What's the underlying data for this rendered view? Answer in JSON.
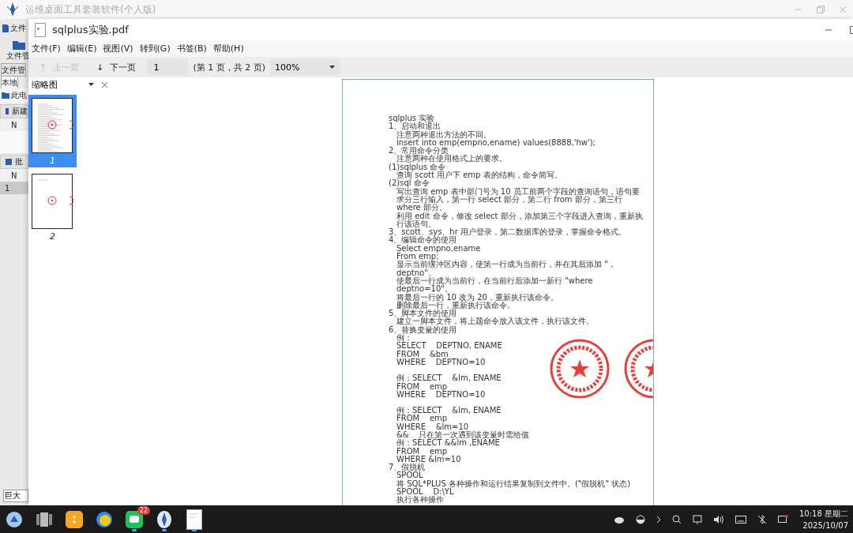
{
  "background_window": {
    "title": "运维桌面工具套装软件(个人版)",
    "sidebar": [
      {
        "kind": "menu",
        "label": "文件"
      },
      {
        "kind": "tool",
        "label": "文件管"
      },
      {
        "kind": "tab",
        "label": "文件管",
        "selected": false
      },
      {
        "kind": "tab",
        "label": "本地",
        "selected": true
      },
      {
        "kind": "tree",
        "label": "此电"
      },
      {
        "kind": "panel",
        "label": "新建"
      },
      {
        "kind": "column",
        "label": "N"
      },
      {
        "kind": "blank"
      },
      {
        "kind": "panel",
        "label": "批"
      },
      {
        "kind": "column",
        "label": "N"
      },
      {
        "kind": "row",
        "label": "1"
      }
    ],
    "size_select": {
      "value": "巨大"
    }
  },
  "viewer": {
    "title": "sqlplus实验.pdf",
    "menu": [
      "文件(F)",
      "编辑(E)",
      "视图(V)",
      "转到(G)",
      "书签(B)",
      "帮助(H)"
    ],
    "toolbar": {
      "prev": {
        "arrow": "↑",
        "label": "上一页",
        "disabled": true
      },
      "next": {
        "arrow": "↓",
        "label": "下一页",
        "disabled": false
      },
      "page_field": "1",
      "page_info": "(第 1 页，共 2 页)",
      "zoom": "100%"
    },
    "thumbnail_panel": {
      "title": "缩略图",
      "pages": [
        {
          "label": "1",
          "selected": true
        },
        {
          "label": "2",
          "selected": false
        }
      ]
    },
    "page_lines": [
      {
        "text": "sqlplus 实验",
        "indent": false
      },
      {
        "text": "1、启动和退出",
        "indent": false
      },
      {
        "text": "注意两种退出方法的不同。",
        "indent": true
      },
      {
        "text": "insert into emp(empno,ename) values(8888,'hw');",
        "indent": true
      },
      {
        "text": "2、常用命令分类",
        "indent": false
      },
      {
        "text": "注意两种在使用格式上的要求。",
        "indent": true
      },
      {
        "text": "(1)sqlplus 命令",
        "indent": false
      },
      {
        "text": "查询 scott 用户下 emp 表的结构，命令简写。",
        "indent": true
      },
      {
        "text": "(2)sql 命令",
        "indent": false
      },
      {
        "text": "写出查询 emp 表中部门号为 10 员工前两个字段的查询语句，语句要求分三行输入，第一行 select 部分，第二行 from 部分，第三行 where 部分。",
        "indent": true
      },
      {
        "text": "利用 edit 命令，修改 select 部分，添加第三个字段进入查询，重新执行该语句。",
        "indent": true
      },
      {
        "text": "3、scott、sys、hr 用户登录，第二数据库的登录，掌握命令格式。",
        "indent": false
      },
      {
        "text": "4、编辑命令的使用",
        "indent": false
      },
      {
        "text": "Select empno,ename",
        "indent": true
      },
      {
        "text": "From emp;",
        "indent": true
      },
      {
        "text": "显示当前缓冲区内容，使第一行成为当前行，并在其后添加 \"，deptno\"。",
        "indent": true
      },
      {
        "text": "使最后一行成为当前行，在当前行后添加一新行 \"where deptno=10\"。",
        "indent": true
      },
      {
        "text": "将最后一行的 10 改为 20，重新执行该命令。",
        "indent": true
      },
      {
        "text": "删除最后一行，重新执行该命令。",
        "indent": true
      },
      {
        "text": "5、脚本文件的使用",
        "indent": false
      },
      {
        "text": "建立一脚本文件，将上题命令放入该文件，执行该文件。",
        "indent": true
      },
      {
        "text": "6、替换变量的使用",
        "indent": false
      },
      {
        "text": "例：",
        "indent": true
      },
      {
        "text": "SELECT    DEPTNO, ENAME",
        "indent": true
      },
      {
        "text": "FROM    &bm",
        "indent": true
      },
      {
        "text": "WHERE    DEPTNO=10",
        "indent": true
      },
      {
        "text": "例：SELECT    &lm, ENAME",
        "indent": true,
        "gap_before": true
      },
      {
        "text": "FROM    emp",
        "indent": true
      },
      {
        "text": "WHERE    DEPTNO=10",
        "indent": true
      },
      {
        "text": "例：SELECT    &lm, ENAME",
        "indent": true,
        "gap_before": true
      },
      {
        "text": "FROM    emp",
        "indent": true
      },
      {
        "text": "WHERE    &lm=10",
        "indent": true
      },
      {
        "text": "&&    只在第一次遇到该变量时需给值",
        "indent": true
      },
      {
        "text": "例：SELECT &&lm ,ENAME",
        "indent": true
      },
      {
        "text": "FROM    emp",
        "indent": true
      },
      {
        "text": "WHERE &lm=10",
        "indent": true
      },
      {
        "text": "7、假脱机",
        "indent": false
      },
      {
        "text": "SPOOL",
        "indent": true
      },
      {
        "text": "将 SQL*PLUS 各种操作和运行结果复制到文件中。(\"假脱机\" 状态)",
        "indent": true
      },
      {
        "text": "SPOOL    D:\\YL",
        "indent": true
      },
      {
        "text": "执行各种操作",
        "indent": true
      }
    ]
  },
  "taskbar": {
    "apps": [
      {
        "kind": "launcher"
      },
      {
        "kind": "multitask"
      },
      {
        "kind": "notes"
      },
      {
        "kind": "browser"
      },
      {
        "kind": "chat",
        "badge": "22",
        "running": true
      },
      {
        "kind": "toolkit",
        "running": true
      },
      {
        "kind": "document",
        "running": true
      }
    ],
    "time": "10:18 星期二",
    "date": "2025/10/07"
  }
}
